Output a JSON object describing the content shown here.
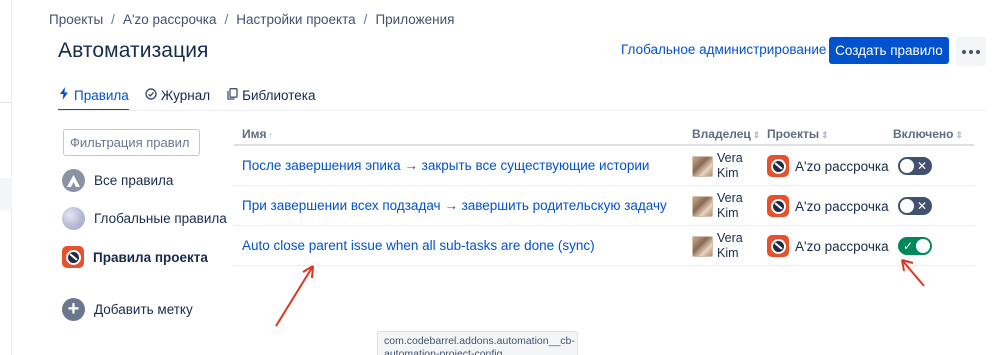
{
  "breadcrumb": [
    "Проекты",
    "A'zo рассрочка",
    "Настройки проекта",
    "Приложения"
  ],
  "page_title": "Автоматизация",
  "header": {
    "global_admin_label": "Глобальное администрирование",
    "create_rule_label": "Создать правило"
  },
  "tabs": [
    {
      "label": "Правила",
      "icon": "lightning-icon",
      "active": true
    },
    {
      "label": "Журнал",
      "icon": "check-circle-icon",
      "active": false
    },
    {
      "label": "Библиотека",
      "icon": "copy-icon",
      "active": false
    }
  ],
  "sidebar": {
    "filter_placeholder": "Фильтрация правил",
    "items": [
      {
        "label": "Все правила",
        "icon": "automation-icon"
      },
      {
        "label": "Глобальные правила",
        "icon": "globe-icon"
      },
      {
        "label": "Правила проекта",
        "icon": "project-icon",
        "active": true
      },
      {
        "label": "Добавить метку",
        "icon": "plus-icon"
      }
    ]
  },
  "table": {
    "columns": [
      "Имя",
      "Владелец",
      "Проекты",
      "Включено"
    ],
    "sort_up": "↑",
    "sort_both": "⇕",
    "rows": [
      {
        "name": "После завершения эпика → закрыть все существующие истории",
        "owner_first": "Vera",
        "owner_last": "Kim",
        "project": "A'zo рассрочка",
        "enabled": false
      },
      {
        "name": "При завершении всех подзадач → завершить родительскую задачу",
        "owner_first": "Vera",
        "owner_last": "Kim",
        "project": "A'zo рассрочка",
        "enabled": false
      },
      {
        "name": "Auto close parent issue when all sub-tasks are done (sync)",
        "owner_first": "Vera",
        "owner_last": "Kim",
        "project": "A'zo рассрочка",
        "enabled": true
      }
    ]
  },
  "tooltip": "com.codebarrel.addons.automation__cb-automation-project-config",
  "colors": {
    "primary": "#0052cc",
    "toggle_off": "#42526e",
    "toggle_on": "#00875a",
    "annotation_arrow": "#e0341e"
  }
}
